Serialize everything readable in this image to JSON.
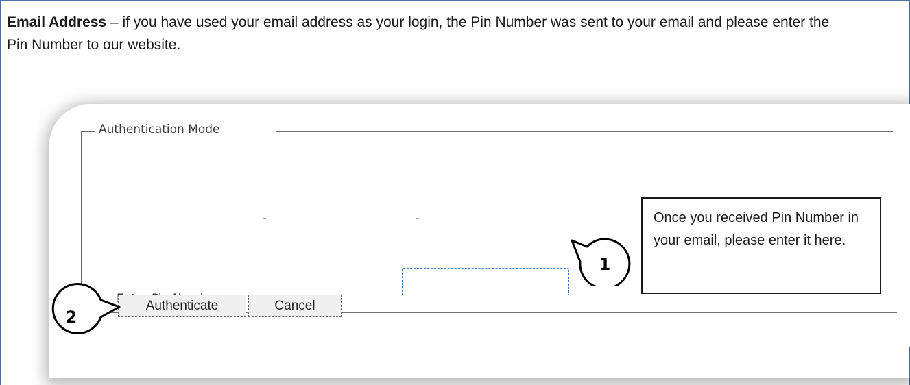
{
  "intro": {
    "bold_label": "Email Address",
    "text": " – if you have used your email address as your login, the Pin Number was sent to your email and please enter the Pin Number to our website."
  },
  "form": {
    "legend": "Authentication Mode",
    "pin_label": "Enter Pin Number:",
    "pin_value": "",
    "authenticate_label": "Authenticate",
    "cancel_label": "Cancel"
  },
  "callouts": {
    "one": "1",
    "two": "2",
    "note": "Once you received Pin Number in your email, please enter it here."
  },
  "colors": {
    "frame_border": "#4b6f9a",
    "input_border": "#3a73c4"
  }
}
